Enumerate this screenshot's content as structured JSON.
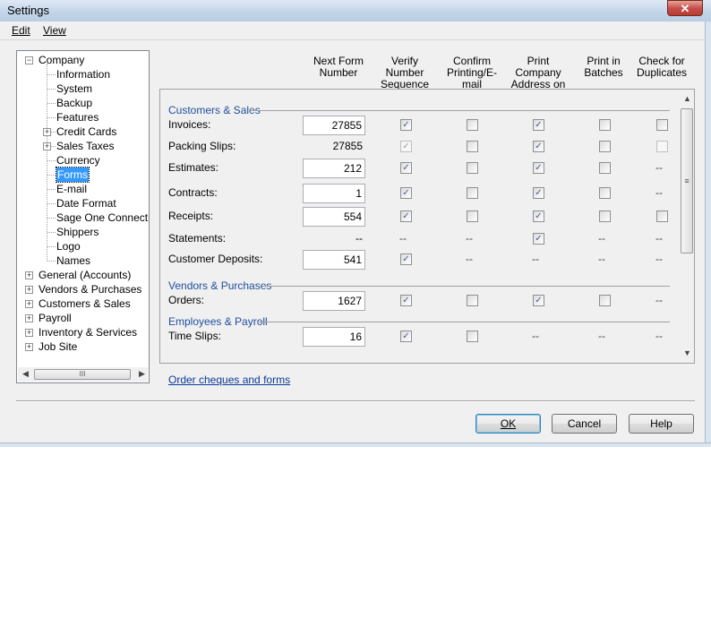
{
  "window": {
    "title": "Settings",
    "close_glyph": "✕"
  },
  "menu": {
    "edit": "Edit",
    "view": "View"
  },
  "tree": {
    "root_label": "Company",
    "children": [
      "Information",
      "System",
      "Backup",
      "Features",
      "Credit Cards",
      "Sales Taxes",
      "Currency",
      "Forms",
      "E-mail",
      "Date Format",
      "Sage One Connection",
      "Shippers",
      "Logo",
      "Names"
    ],
    "selected": "Forms",
    "top_level": [
      "General (Accounts)",
      "Vendors & Purchases",
      "Customers & Sales",
      "Payroll",
      "Inventory & Services",
      "Job Site"
    ],
    "scroll_grip": "III"
  },
  "columns": [
    {
      "line1": "Next Form",
      "line2": "Number"
    },
    {
      "line1": "Verify Number",
      "line2": "Sequence"
    },
    {
      "line1": "Confirm",
      "line2": "Printing/E-mail"
    },
    {
      "line1": "Print Company",
      "line2": "Address on"
    },
    {
      "line1": "Print in",
      "line2": "Batches"
    },
    {
      "line1": "Check for",
      "line2": "Duplicates"
    }
  ],
  "sections": [
    {
      "title": "Customers & Sales"
    },
    {
      "title": "Vendors & Purchases"
    },
    {
      "title": "Employees & Payroll"
    }
  ],
  "rows": [
    {
      "label": "Invoices:",
      "number": "27855"
    },
    {
      "label": "Packing Slips:",
      "number": "27855"
    },
    {
      "label": "Estimates:",
      "number": "212"
    },
    {
      "label": "Contracts:",
      "number": "1"
    },
    {
      "label": "Receipts:",
      "number": "554"
    },
    {
      "label": "Statements:",
      "number": "--"
    },
    {
      "label": "Customer Deposits:",
      "number": "541"
    },
    {
      "label": "Orders:",
      "number": "1627"
    },
    {
      "label": "Time Slips:",
      "number": "16"
    }
  ],
  "cell_states_legend": "check = checked box, empty = unchecked box, dim = disabled box, dash = not applicable",
  "check_glyph": "✓",
  "dash_text": "--",
  "cells": [
    [
      "check",
      "empty",
      "check",
      "empty",
      "empty"
    ],
    [
      "dimcheck",
      "empty",
      "check",
      "empty",
      "dim"
    ],
    [
      "check",
      "empty",
      "check",
      "empty",
      "dash"
    ],
    [
      "check",
      "empty",
      "check",
      "empty",
      "dash"
    ],
    [
      "check",
      "empty",
      "check",
      "empty",
      "empty"
    ],
    [
      "dash",
      "dash",
      "check",
      "dash",
      "dash"
    ],
    [
      "check",
      "dash",
      "dash",
      "dash",
      "dash"
    ],
    [
      "check",
      "empty",
      "check",
      "empty",
      "dash"
    ],
    [
      "check",
      "empty",
      "dash",
      "dash",
      "dash"
    ]
  ],
  "link": "Order cheques and forms",
  "buttons": {
    "ok": "OK",
    "cancel": "Cancel",
    "help": "Help"
  },
  "scroll_grip_v": "≡"
}
